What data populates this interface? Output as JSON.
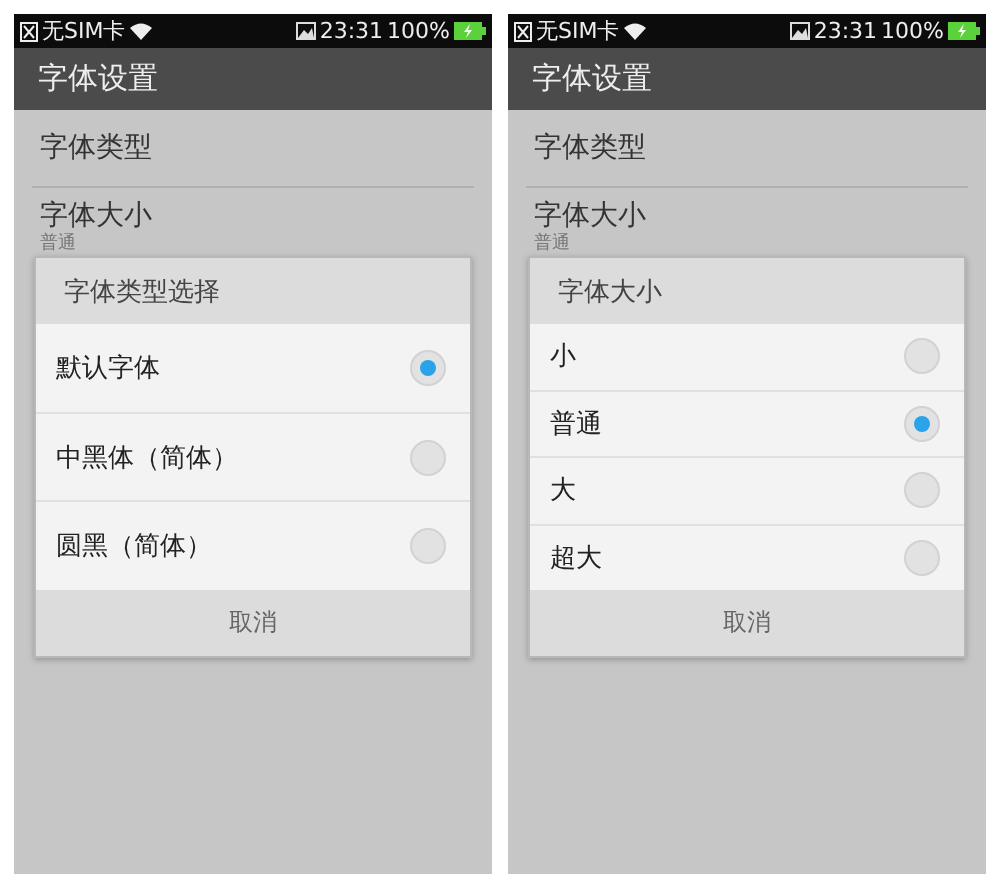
{
  "screens": [
    {
      "status_bar": {
        "carrier": "无SIM卡",
        "time": "23:31",
        "battery": "100%"
      },
      "title": "字体设置",
      "settings": [
        {
          "label": "字体类型"
        },
        {
          "label": "字体大小",
          "value": "普通"
        }
      ],
      "dialog": {
        "title": "字体类型选择",
        "options": [
          {
            "label": "默认字体",
            "selected": true
          },
          {
            "label": "中黑体（简体）",
            "selected": false
          },
          {
            "label": "圆黑（简体）",
            "selected": false
          }
        ],
        "cancel": "取消"
      }
    },
    {
      "status_bar": {
        "carrier": "无SIM卡",
        "time": "23:31",
        "battery": "100%"
      },
      "title": "字体设置",
      "settings": [
        {
          "label": "字体类型"
        },
        {
          "label": "字体大小",
          "value": "普通"
        }
      ],
      "dialog": {
        "title": "字体大小",
        "options": [
          {
            "label": "小",
            "selected": false
          },
          {
            "label": "普通",
            "selected": true
          },
          {
            "label": "大",
            "selected": false
          },
          {
            "label": "超大",
            "selected": false
          }
        ],
        "cancel": "取消"
      }
    }
  ]
}
